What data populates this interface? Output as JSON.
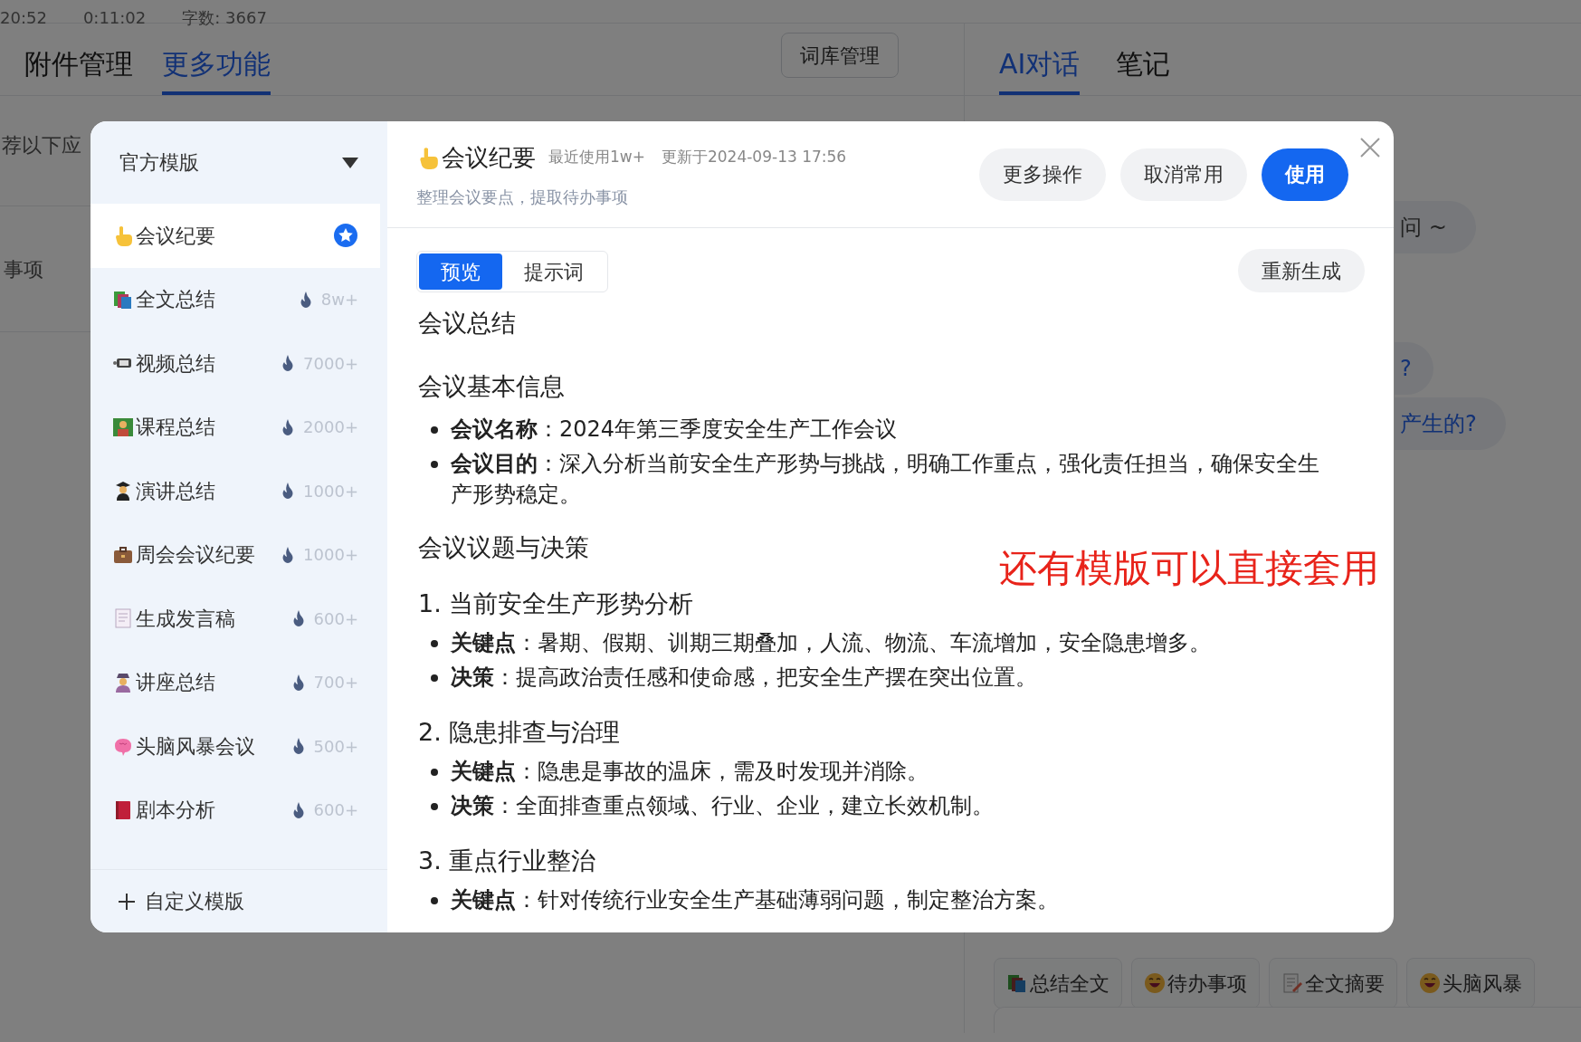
{
  "status_bar": {
    "items": [
      "20:52",
      "0:11:02",
      "字数: 3667"
    ]
  },
  "left_panel": {
    "tabs": [
      {
        "label": "附件管理",
        "selected": false
      },
      {
        "label": "更多功能",
        "selected": true
      }
    ],
    "lexicon_button": "词库管理",
    "fragments": [
      "荐以下应",
      "事项"
    ]
  },
  "right_panel": {
    "tabs": [
      {
        "label": "AI对话",
        "selected": true
      },
      {
        "label": "笔记",
        "selected": false
      }
    ],
    "bubbles": [
      "问 ~",
      "?",
      "产生的?"
    ],
    "chips": [
      "总结全文",
      "待办事项",
      "全文摘要",
      "头脑风暴"
    ]
  },
  "dialog": {
    "sidebar": {
      "dropdown": "官方模版",
      "items": [
        {
          "label": "会议纪要",
          "selected": true,
          "favorite": true
        },
        {
          "label": "全文总结",
          "count": "8w+",
          "selected": false,
          "favorite": false
        },
        {
          "label": "视频总结",
          "count": "7000+",
          "selected": false,
          "favorite": false
        },
        {
          "label": "课程总结",
          "count": "2000+",
          "selected": false,
          "favorite": false
        },
        {
          "label": "演讲总结",
          "count": "1000+",
          "selected": false,
          "favorite": false
        },
        {
          "label": "周会会议纪要",
          "count": "1000+",
          "selected": false,
          "favorite": false
        },
        {
          "label": "生成发言稿",
          "count": "600+",
          "selected": false,
          "favorite": false
        },
        {
          "label": "讲座总结",
          "count": "700+",
          "selected": false,
          "favorite": false
        },
        {
          "label": "头脑风暴会议",
          "count": "500+",
          "selected": false,
          "favorite": false
        },
        {
          "label": "剧本分析",
          "count": "600+",
          "selected": false,
          "favorite": false
        }
      ],
      "add_button": "自定义模版"
    },
    "header": {
      "title": "会议纪要",
      "usage": "最近使用1w+",
      "updated": "更新于2024-09-13 17:56",
      "description": "整理会议要点，提取待办事项",
      "buttons": [
        {
          "label": "更多操作",
          "kind": "secondary"
        },
        {
          "label": "取消常用",
          "kind": "secondary"
        },
        {
          "label": "使用",
          "kind": "primary"
        }
      ]
    },
    "tabs": [
      {
        "label": "预览",
        "selected": true
      },
      {
        "label": "提示词",
        "selected": false
      }
    ],
    "regenerate_button": "重新生成",
    "content": [
      {
        "kind": "h1",
        "text": "会议总结"
      },
      {
        "kind": "h2",
        "text": "会议基本信息"
      },
      {
        "kind": "bullet",
        "text": "**会议名称**：2024年第三季度安全生产工作会议"
      },
      {
        "kind": "bullet",
        "text": "**会议目的**：深入分析当前安全生产形势与挑战，明确工作重点，强化责任担当，确保安全生产形势稳定。"
      },
      {
        "kind": "h2",
        "text": "会议议题与决策"
      },
      {
        "kind": "h3",
        "text": "1. 当前安全生产形势分析"
      },
      {
        "kind": "bullet",
        "text": "**关键点**：暑期、假期、训期三期叠加，人流、物流、车流增加，安全隐患增多。"
      },
      {
        "kind": "bullet",
        "text": "**决策**：提高政治责任感和使命感，把安全生产摆在突出位置。"
      },
      {
        "kind": "h3",
        "text": "2. 隐患排查与治理"
      },
      {
        "kind": "bullet",
        "text": "**关键点**：隐患是事故的温床，需及时发现并消除。"
      },
      {
        "kind": "bullet",
        "text": "**决策**：全面排查重点领域、行业、企业，建立长效机制。"
      },
      {
        "kind": "h3",
        "text": "3. 重点行业整治"
      },
      {
        "kind": "bullet",
        "text": "**关键点**：针对传统行业安全生产基础薄弱问题，制定整治方案。"
      }
    ],
    "annotation": "还有模版可以直接套用"
  }
}
